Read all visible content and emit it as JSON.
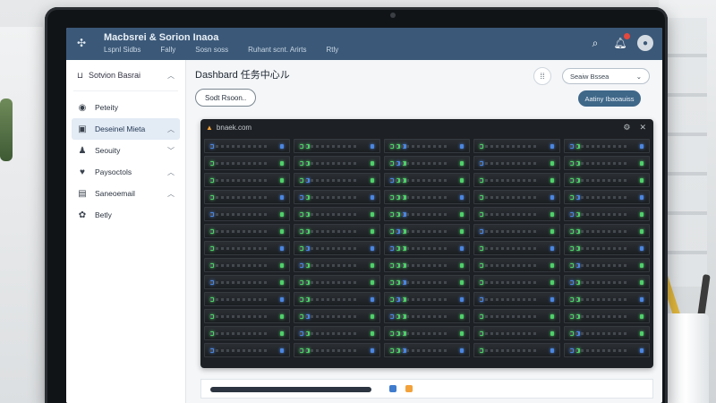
{
  "app": {
    "title": "Macbsrei & Sorion Inaoa",
    "nav": [
      "Lspnl Sidbs",
      "Fally",
      "Sosn soss",
      "Ruhant scnt. Arirts",
      "Rtly"
    ]
  },
  "header": {
    "icons": [
      "search-icon",
      "bell-icon",
      "user-avatar"
    ]
  },
  "sidebar": {
    "head": {
      "label": "Sotvion Basrai"
    },
    "items": [
      {
        "label": "Peteity",
        "icon": "circle-icon",
        "chevron": false,
        "active": false
      },
      {
        "label": "Deseinel Mieta",
        "icon": "doc-icon",
        "chevron": true,
        "active": true
      },
      {
        "label": "Seouity",
        "icon": "user-icon",
        "chevron": true,
        "active": false
      },
      {
        "label": "Paysoctols",
        "icon": "heart-icon",
        "chevron": true,
        "active": false
      },
      {
        "label": "Saneoemail",
        "icon": "grid-icon",
        "chevron": true,
        "active": false
      },
      {
        "label": "Betly",
        "icon": "gear-icon",
        "chevron": false,
        "active": false
      }
    ]
  },
  "main": {
    "title": "Dashbard 任务中心ル",
    "select_value": "Seaiw Bssea",
    "outline_btn": "Sodt Rsoon..",
    "primary_btn": "Aatiny Ibaoauiss"
  },
  "panel": {
    "site": "bnaek.com"
  },
  "colors": {
    "header": "#3b5878",
    "primary": "#3f6788",
    "led_green": "#4fd06a",
    "led_blue": "#4b86e0",
    "tag_red": "#c3443a"
  }
}
